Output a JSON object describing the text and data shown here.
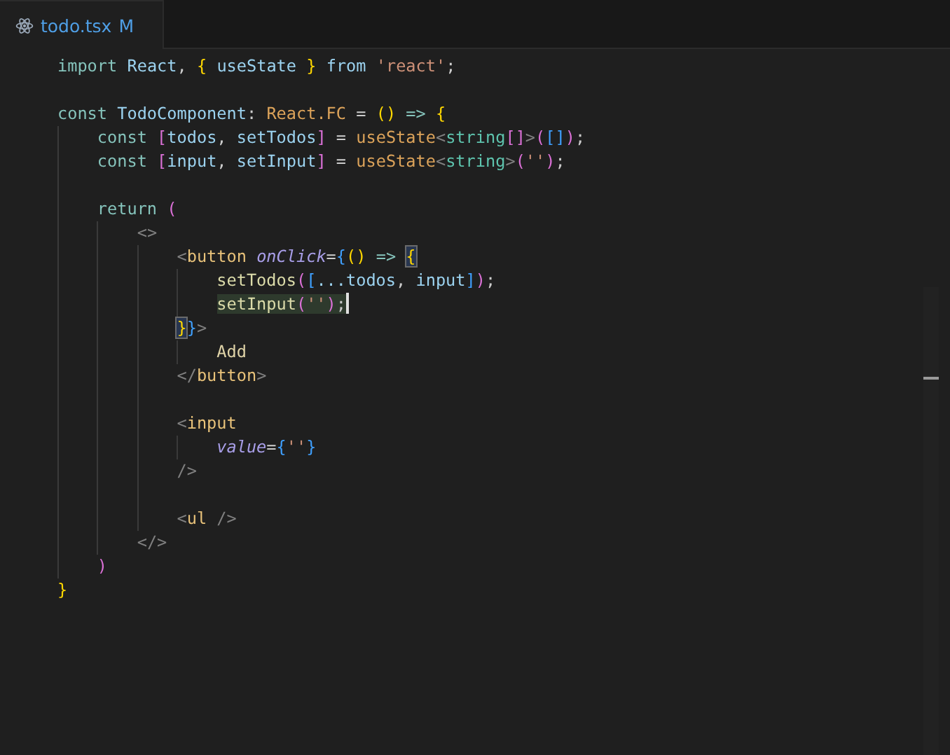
{
  "tab": {
    "file": "todo.tsx",
    "status": "M",
    "selected": true
  },
  "lines": [
    {
      "kind": "code",
      "text": "import React, { useState } from 'react';"
    },
    {
      "kind": "blank"
    },
    {
      "kind": "code",
      "text": "const TodoComponent: React.FC = () => {"
    },
    {
      "kind": "code",
      "text": "    const [todos, setTodos] = useState<string[]>([]);"
    },
    {
      "kind": "code",
      "text": "    const [input, setInput] = useState<string>('');"
    },
    {
      "kind": "blank"
    },
    {
      "kind": "code",
      "text": "    return ("
    },
    {
      "kind": "code",
      "text": "        <>"
    },
    {
      "kind": "code",
      "text": "            <button onClick={() => {",
      "open_bracket_matched": true
    },
    {
      "kind": "code",
      "text": "                setTodos([...todos, input]);"
    },
    {
      "kind": "code",
      "text": "                setInput('');",
      "current": true
    },
    {
      "kind": "code",
      "text": "            }}>",
      "close_bracket_matched": true
    },
    {
      "kind": "code",
      "text": "                Add"
    },
    {
      "kind": "code",
      "text": "            </button>"
    },
    {
      "kind": "blank"
    },
    {
      "kind": "code",
      "text": "            <input"
    },
    {
      "kind": "code",
      "text": "                value={''}"
    },
    {
      "kind": "code",
      "text": "            />"
    },
    {
      "kind": "blank"
    },
    {
      "kind": "code",
      "text": "            <ul />"
    },
    {
      "kind": "code",
      "text": "        </>"
    },
    {
      "kind": "code",
      "text": "    )"
    },
    {
      "kind": "code",
      "text": "}"
    }
  ]
}
